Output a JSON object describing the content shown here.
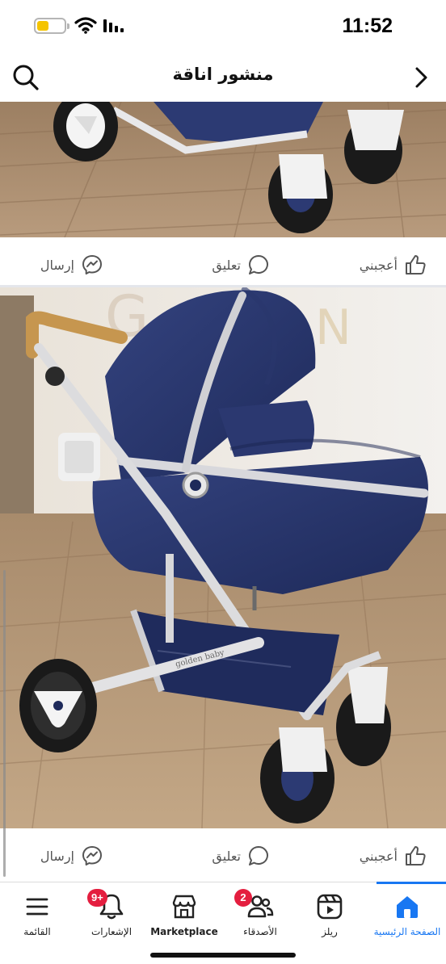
{
  "status_bar": {
    "time": "11:52",
    "battery_color": "#f5c400"
  },
  "header": {
    "title": "منشور اناقة"
  },
  "post_actions": {
    "like": "أعجبني",
    "comment": "تعليق",
    "send": "إرسال"
  },
  "photo_2": {
    "brand_text": "golden baby"
  },
  "bottom_nav": {
    "active_color": "#1877f2",
    "items": [
      {
        "label": "الصفحة الرئيسية",
        "icon": "home-icon",
        "active": true
      },
      {
        "label": "ريلز",
        "icon": "reels-icon"
      },
      {
        "label": "الأصدقاء",
        "icon": "friends-icon",
        "badge": "2"
      },
      {
        "label": "Marketplace",
        "icon": "marketplace-icon"
      },
      {
        "label": "الإشعارات",
        "icon": "bell-icon",
        "badge": "9+"
      },
      {
        "label": "القائمة",
        "icon": "menu-icon"
      }
    ]
  }
}
